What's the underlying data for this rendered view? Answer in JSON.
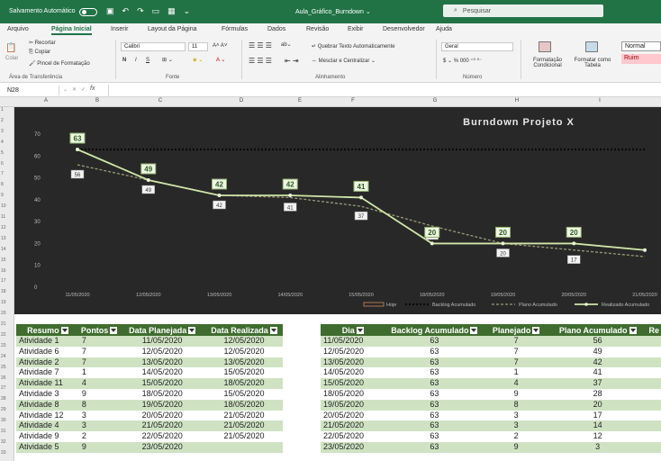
{
  "titlebar": {
    "autosave_label": "Salvamento Automático",
    "doc_name": "Aula_Gráfico_Burndown  ⌄",
    "search_placeholder": "Pesquisar"
  },
  "tabs": [
    "Arquivo",
    "Página Inicial",
    "Inserir",
    "Layout da Página",
    "Fórmulas",
    "Dados",
    "Revisão",
    "Exibir",
    "Desenvolvedor",
    "Ajuda"
  ],
  "ribbon": {
    "clipboard": {
      "cut": "Recortar",
      "copy": "Copiar",
      "paste": "Colar",
      "format_painter": "Pincel de Formatação",
      "group": "Área de Transferência"
    },
    "font": {
      "name": "Calibri",
      "size": "11",
      "group": "Fonte"
    },
    "alignment": {
      "wrap": "Quebrar Texto Automaticamente",
      "merge": "Mesclar e Centralizar",
      "group": "Alinhamento"
    },
    "number": {
      "format": "Geral",
      "group": "Número"
    },
    "styles": {
      "cond_format": "Formatação Condicional",
      "format_table": "Formatar como Tabela",
      "normal": "Normal",
      "bad": "Ruim"
    }
  },
  "formula_bar": {
    "name_box": "N28",
    "fx": "fx"
  },
  "columns": [
    "A",
    "B",
    "C",
    "D",
    "E",
    "F",
    "G",
    "H",
    "I"
  ],
  "colors": {
    "excel_green": "#217346",
    "header_green": "#3f6d2f",
    "band_green": "#cfe3c3",
    "chart_bg": "#282828",
    "line": "#cfe6a8",
    "planned": "#9a9a7a"
  },
  "chart_data": {
    "type": "line",
    "title": "Burndown Projeto X",
    "categories": [
      "11/05/2020",
      "12/05/2020",
      "13/05/2020",
      "14/05/2020",
      "15/05/2020",
      "18/05/2020",
      "19/05/2020",
      "20/05/2020",
      "21/05/2020"
    ],
    "ylim": [
      0,
      70
    ],
    "yticks": [
      0,
      10,
      20,
      30,
      40,
      50,
      60,
      70
    ],
    "series": [
      {
        "name": "Hoje",
        "values": []
      },
      {
        "name": "Backlog Acumulado",
        "values": [
          63,
          63,
          63,
          63,
          63,
          63,
          63,
          63,
          63
        ]
      },
      {
        "name": "Plano Acumulado",
        "values": [
          56,
          49,
          42,
          41,
          37,
          28,
          20,
          17,
          14
        ]
      },
      {
        "name": "Realizado Acumulado",
        "values": [
          63,
          49,
          42,
          42,
          41,
          20,
          20,
          20,
          17
        ]
      }
    ],
    "legend": "bottom",
    "grid": false
  },
  "table_left": {
    "headers": [
      "Resumo",
      "Pontos",
      "Data Planejada",
      "Data Realizada"
    ],
    "rows": [
      [
        "Atividade 1",
        "7",
        "11/05/2020",
        "12/05/2020"
      ],
      [
        "Atividade 6",
        "7",
        "12/05/2020",
        "12/05/2020"
      ],
      [
        "Atividade 2",
        "7",
        "13/05/2020",
        "13/05/2020"
      ],
      [
        "Atividade 7",
        "1",
        "14/05/2020",
        "15/05/2020"
      ],
      [
        "Atividade 11",
        "4",
        "15/05/2020",
        "18/05/2020"
      ],
      [
        "Atividade 3",
        "9",
        "18/05/2020",
        "15/05/2020"
      ],
      [
        "Atividade 8",
        "8",
        "19/05/2020",
        "18/05/2020"
      ],
      [
        "Atividade 12",
        "3",
        "20/05/2020",
        "21/05/2020"
      ],
      [
        "Atividade 4",
        "3",
        "21/05/2020",
        "21/05/2020"
      ],
      [
        "Atividade 9",
        "2",
        "22/05/2020",
        "21/05/2020"
      ],
      [
        "Atividade 5",
        "9",
        "23/05/2020",
        ""
      ]
    ]
  },
  "table_right": {
    "headers": [
      "Dia",
      "Backlog Acumulado",
      "Planejado",
      "Plano Acumulado",
      "Re"
    ],
    "rows": [
      [
        "11/05/2020",
        "63",
        "7",
        "56"
      ],
      [
        "12/05/2020",
        "63",
        "7",
        "49"
      ],
      [
        "13/05/2020",
        "63",
        "7",
        "42"
      ],
      [
        "14/05/2020",
        "63",
        "1",
        "41"
      ],
      [
        "15/05/2020",
        "63",
        "4",
        "37"
      ],
      [
        "18/05/2020",
        "63",
        "9",
        "28"
      ],
      [
        "19/05/2020",
        "63",
        "8",
        "20"
      ],
      [
        "20/05/2020",
        "63",
        "3",
        "17"
      ],
      [
        "21/05/2020",
        "63",
        "3",
        "14"
      ],
      [
        "22/05/2020",
        "63",
        "2",
        "12"
      ],
      [
        "23/05/2020",
        "63",
        "9",
        "3"
      ]
    ]
  }
}
